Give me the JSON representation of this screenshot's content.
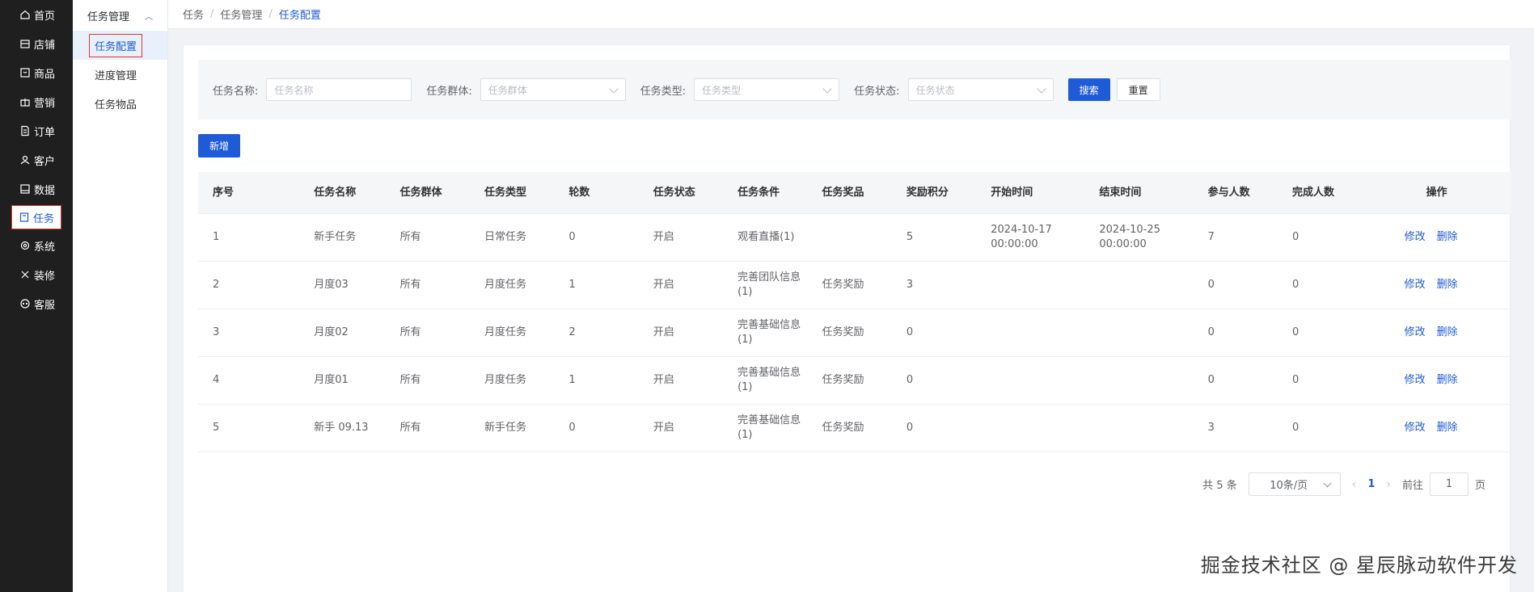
{
  "nav": [
    {
      "label": "首页",
      "icon": "home-icon"
    },
    {
      "label": "店铺",
      "icon": "shop-icon"
    },
    {
      "label": "商品",
      "icon": "goods-icon"
    },
    {
      "label": "营销",
      "icon": "gift-icon"
    },
    {
      "label": "订单",
      "icon": "order-icon"
    },
    {
      "label": "客户",
      "icon": "customer-icon"
    },
    {
      "label": "数据",
      "icon": "data-icon"
    },
    {
      "label": "任务",
      "icon": "task-icon"
    },
    {
      "label": "系统",
      "icon": "gear-icon"
    },
    {
      "label": "装修",
      "icon": "decorate-icon"
    },
    {
      "label": "客服",
      "icon": "chat-icon"
    }
  ],
  "submenu": {
    "head": "任务管理",
    "items": [
      "任务配置",
      "进度管理",
      "任务物品"
    ]
  },
  "breadcrumb": [
    "任务",
    "任务管理",
    "任务配置"
  ],
  "filter": {
    "name_label": "任务名称:",
    "name_placeholder": "任务名称",
    "group_label": "任务群体:",
    "group_placeholder": "任务群体",
    "type_label": "任务类型:",
    "type_placeholder": "任务类型",
    "status_label": "任务状态:",
    "status_placeholder": "任务状态",
    "search": "搜索",
    "reset": "重置"
  },
  "add_button": "新增",
  "table": {
    "headers": [
      "序号",
      "任务名称",
      "任务群体",
      "任务类型",
      "轮数",
      "任务状态",
      "任务条件",
      "任务奖品",
      "奖励积分",
      "开始时间",
      "结束时间",
      "参与人数",
      "完成人数",
      "操作"
    ],
    "rows": [
      [
        "1",
        "新手任务",
        "所有",
        "日常任务",
        "0",
        "开启",
        "观看直播(1)",
        "",
        "5",
        "2024-10-17 00:00:00",
        "2024-10-25 00:00:00",
        "7",
        "0"
      ],
      [
        "2",
        "月度03",
        "所有",
        "月度任务",
        "1",
        "开启",
        "完善团队信息(1)",
        "任务奖励",
        "3",
        "",
        "",
        "0",
        "0"
      ],
      [
        "3",
        "月度02",
        "所有",
        "月度任务",
        "2",
        "开启",
        "完善基础信息(1)",
        "任务奖励",
        "0",
        "",
        "",
        "0",
        "0"
      ],
      [
        "4",
        "月度01",
        "所有",
        "月度任务",
        "1",
        "开启",
        "完善基础信息(1)",
        "任务奖励",
        "0",
        "",
        "",
        "0",
        "0"
      ],
      [
        "5",
        "新手 09.13",
        "所有",
        "新手任务",
        "0",
        "开启",
        "完善基础信息(1)",
        "任务奖励",
        "0",
        "",
        "",
        "3",
        "0"
      ]
    ],
    "edit_label": "修改",
    "delete_label": "删除"
  },
  "pagination": {
    "total": "共 5 条",
    "page_size": "10条/页",
    "current": "1",
    "goto_label": "前往",
    "goto_value": "1",
    "page_suffix": "页"
  },
  "watermark": "掘金技术社区 @ 星辰脉动软件开发"
}
